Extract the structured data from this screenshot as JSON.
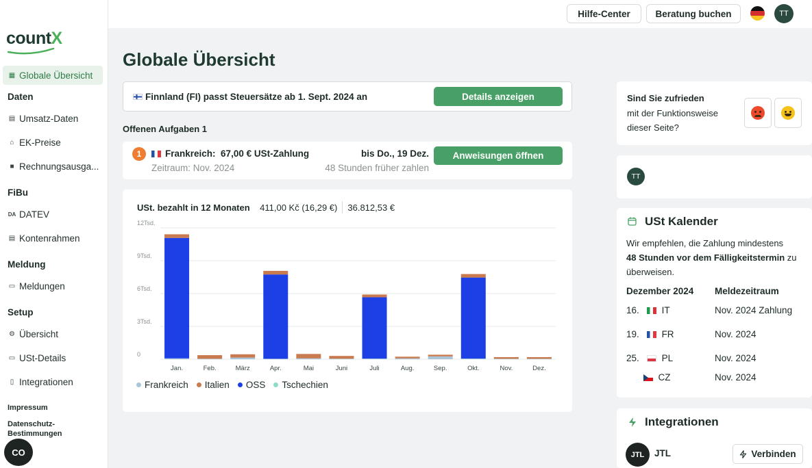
{
  "brand": {
    "logo_main": "count",
    "logo_x": "X"
  },
  "sidebar": {
    "active": {
      "label": "Globale Übersicht"
    },
    "sections": [
      {
        "title": "Daten",
        "items": [
          {
            "label": "Umsatz-Daten"
          },
          {
            "label": "EK-Preise"
          },
          {
            "label": "Rechnungsausga..."
          }
        ]
      },
      {
        "title": "FiBu",
        "items": [
          {
            "label": "DATEV"
          },
          {
            "label": "Kontenrahmen"
          }
        ]
      },
      {
        "title": "Meldung",
        "items": [
          {
            "label": "Meldungen"
          }
        ]
      },
      {
        "title": "Setup",
        "items": [
          {
            "label": "Übersicht"
          },
          {
            "label": "USt-Details"
          },
          {
            "label": "Integrationen"
          }
        ]
      }
    ],
    "footer": {
      "impressum": "Impressum",
      "datenschutz": "Datenschutz-Bestimmungen"
    },
    "cookie_label": "CO"
  },
  "header": {
    "help_label": "Hilfe-Center",
    "consult_label": "Beratung buchen",
    "avatar_initials": "TT"
  },
  "page": {
    "title": "Globale Übersicht"
  },
  "notice": {
    "text": "Finnland (FI) passt Steuersätze ab 1. Sept. 2024 an",
    "button": "Details anzeigen"
  },
  "tasks": {
    "title": "Offenen Aufgaben 1",
    "item": {
      "number": "1",
      "country": "Frankreich:",
      "amount": "67,00 € USt-Zahlung",
      "period": "Zeitraum: Nov. 2024",
      "due": "bis Do., 19 Dez.",
      "hint": "48 Stunden früher zahlen",
      "button": "Anweisungen öffnen"
    }
  },
  "chart_card": {
    "title": "USt. bezahlt in 12 Monaten",
    "amount_czk": "411,00 Kč (16,29 €)",
    "amount_eur": "36.812,53 €"
  },
  "chart_data": {
    "type": "bar",
    "stacked": true,
    "categories": [
      "Jan.",
      "Feb.",
      "März",
      "Apr.",
      "Mai",
      "Juni",
      "Juli",
      "Aug.",
      "Sep.",
      "Okt.",
      "Nov.",
      "Dez."
    ],
    "ytick_labels": [
      "0",
      "3Tsd.",
      "6Tsd.",
      "9Tsd.",
      "12Tsd."
    ],
    "ylim": [
      0,
      12000
    ],
    "grid": true,
    "legend_position": "bottom-left",
    "series": [
      {
        "name": "Frankreich",
        "color": "#a8c6d8",
        "values": [
          80,
          40,
          150,
          40,
          80,
          50,
          60,
          80,
          260,
          60,
          40,
          40
        ]
      },
      {
        "name": "OSS",
        "color": "#1d3fe6",
        "values": [
          11000,
          0,
          0,
          7700,
          0,
          0,
          5600,
          0,
          0,
          7400,
          0,
          0
        ]
      },
      {
        "name": "Tschechien",
        "color": "#8ddcc9",
        "values": [
          0,
          0,
          0,
          0,
          0,
          0,
          0,
          0,
          0,
          0,
          0,
          0
        ]
      },
      {
        "name": "Italien",
        "color": "#c97a4f",
        "values": [
          330,
          330,
          300,
          330,
          400,
          250,
          250,
          150,
          150,
          320,
          150,
          150
        ]
      }
    ]
  },
  "feedback": {
    "line1": "Sind Sie zufrieden",
    "line2": "mit der Funktionsweise",
    "line3": "dieser Seite?"
  },
  "user_card": {
    "initials": "TT"
  },
  "calendar": {
    "title": "USt Kalender",
    "text1": "Wir empfehlen, die Zahlung mindestens",
    "text2_bold": "48 Stunden vor dem Fälligkeitstermin",
    "text2_rest": " zu",
    "text3": "überweisen.",
    "col1": "Dezember 2024",
    "col2": "Meldezeitraum",
    "rows": [
      {
        "day": "16.",
        "code": "IT",
        "period": "Nov. 2024 Zahlung"
      },
      {
        "day": "19.",
        "code": "FR",
        "period": "Nov. 2024"
      },
      {
        "day": "25.",
        "code": "PL",
        "period": "Nov. 2024"
      },
      {
        "day": "",
        "code": "CZ",
        "period": "Nov. 2024"
      }
    ]
  },
  "integrations": {
    "title": "Integrationen",
    "item_logo": "JTL",
    "item_name": "JTL",
    "button": "Verbinden"
  }
}
